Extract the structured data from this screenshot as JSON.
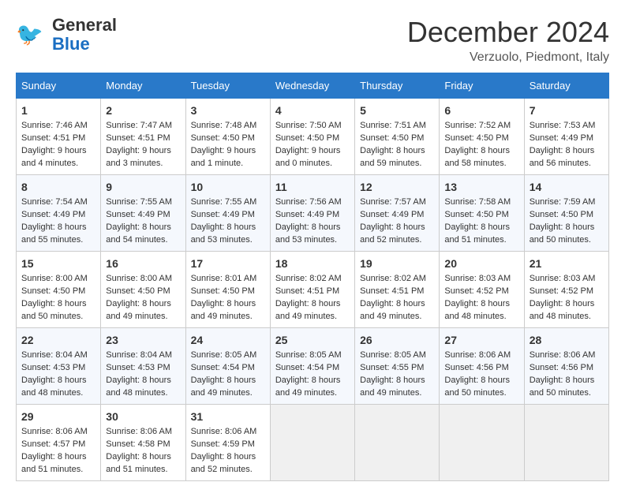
{
  "header": {
    "logo_general": "General",
    "logo_blue": "Blue",
    "month": "December 2024",
    "location": "Verzuolo, Piedmont, Italy"
  },
  "weekdays": [
    "Sunday",
    "Monday",
    "Tuesday",
    "Wednesday",
    "Thursday",
    "Friday",
    "Saturday"
  ],
  "weeks": [
    [
      {
        "day": "1",
        "info": "Sunrise: 7:46 AM\nSunset: 4:51 PM\nDaylight: 9 hours\nand 4 minutes."
      },
      {
        "day": "2",
        "info": "Sunrise: 7:47 AM\nSunset: 4:51 PM\nDaylight: 9 hours\nand 3 minutes."
      },
      {
        "day": "3",
        "info": "Sunrise: 7:48 AM\nSunset: 4:50 PM\nDaylight: 9 hours\nand 1 minute."
      },
      {
        "day": "4",
        "info": "Sunrise: 7:50 AM\nSunset: 4:50 PM\nDaylight: 9 hours\nand 0 minutes."
      },
      {
        "day": "5",
        "info": "Sunrise: 7:51 AM\nSunset: 4:50 PM\nDaylight: 8 hours\nand 59 minutes."
      },
      {
        "day": "6",
        "info": "Sunrise: 7:52 AM\nSunset: 4:50 PM\nDaylight: 8 hours\nand 58 minutes."
      },
      {
        "day": "7",
        "info": "Sunrise: 7:53 AM\nSunset: 4:49 PM\nDaylight: 8 hours\nand 56 minutes."
      }
    ],
    [
      {
        "day": "8",
        "info": "Sunrise: 7:54 AM\nSunset: 4:49 PM\nDaylight: 8 hours\nand 55 minutes."
      },
      {
        "day": "9",
        "info": "Sunrise: 7:55 AM\nSunset: 4:49 PM\nDaylight: 8 hours\nand 54 minutes."
      },
      {
        "day": "10",
        "info": "Sunrise: 7:55 AM\nSunset: 4:49 PM\nDaylight: 8 hours\nand 53 minutes."
      },
      {
        "day": "11",
        "info": "Sunrise: 7:56 AM\nSunset: 4:49 PM\nDaylight: 8 hours\nand 53 minutes."
      },
      {
        "day": "12",
        "info": "Sunrise: 7:57 AM\nSunset: 4:49 PM\nDaylight: 8 hours\nand 52 minutes."
      },
      {
        "day": "13",
        "info": "Sunrise: 7:58 AM\nSunset: 4:50 PM\nDaylight: 8 hours\nand 51 minutes."
      },
      {
        "day": "14",
        "info": "Sunrise: 7:59 AM\nSunset: 4:50 PM\nDaylight: 8 hours\nand 50 minutes."
      }
    ],
    [
      {
        "day": "15",
        "info": "Sunrise: 8:00 AM\nSunset: 4:50 PM\nDaylight: 8 hours\nand 50 minutes."
      },
      {
        "day": "16",
        "info": "Sunrise: 8:00 AM\nSunset: 4:50 PM\nDaylight: 8 hours\nand 49 minutes."
      },
      {
        "day": "17",
        "info": "Sunrise: 8:01 AM\nSunset: 4:50 PM\nDaylight: 8 hours\nand 49 minutes."
      },
      {
        "day": "18",
        "info": "Sunrise: 8:02 AM\nSunset: 4:51 PM\nDaylight: 8 hours\nand 49 minutes."
      },
      {
        "day": "19",
        "info": "Sunrise: 8:02 AM\nSunset: 4:51 PM\nDaylight: 8 hours\nand 49 minutes."
      },
      {
        "day": "20",
        "info": "Sunrise: 8:03 AM\nSunset: 4:52 PM\nDaylight: 8 hours\nand 48 minutes."
      },
      {
        "day": "21",
        "info": "Sunrise: 8:03 AM\nSunset: 4:52 PM\nDaylight: 8 hours\nand 48 minutes."
      }
    ],
    [
      {
        "day": "22",
        "info": "Sunrise: 8:04 AM\nSunset: 4:53 PM\nDaylight: 8 hours\nand 48 minutes."
      },
      {
        "day": "23",
        "info": "Sunrise: 8:04 AM\nSunset: 4:53 PM\nDaylight: 8 hours\nand 48 minutes."
      },
      {
        "day": "24",
        "info": "Sunrise: 8:05 AM\nSunset: 4:54 PM\nDaylight: 8 hours\nand 49 minutes."
      },
      {
        "day": "25",
        "info": "Sunrise: 8:05 AM\nSunset: 4:54 PM\nDaylight: 8 hours\nand 49 minutes."
      },
      {
        "day": "26",
        "info": "Sunrise: 8:05 AM\nSunset: 4:55 PM\nDaylight: 8 hours\nand 49 minutes."
      },
      {
        "day": "27",
        "info": "Sunrise: 8:06 AM\nSunset: 4:56 PM\nDaylight: 8 hours\nand 50 minutes."
      },
      {
        "day": "28",
        "info": "Sunrise: 8:06 AM\nSunset: 4:56 PM\nDaylight: 8 hours\nand 50 minutes."
      }
    ],
    [
      {
        "day": "29",
        "info": "Sunrise: 8:06 AM\nSunset: 4:57 PM\nDaylight: 8 hours\nand 51 minutes."
      },
      {
        "day": "30",
        "info": "Sunrise: 8:06 AM\nSunset: 4:58 PM\nDaylight: 8 hours\nand 51 minutes."
      },
      {
        "day": "31",
        "info": "Sunrise: 8:06 AM\nSunset: 4:59 PM\nDaylight: 8 hours\nand 52 minutes."
      },
      {
        "day": "",
        "info": ""
      },
      {
        "day": "",
        "info": ""
      },
      {
        "day": "",
        "info": ""
      },
      {
        "day": "",
        "info": ""
      }
    ]
  ]
}
